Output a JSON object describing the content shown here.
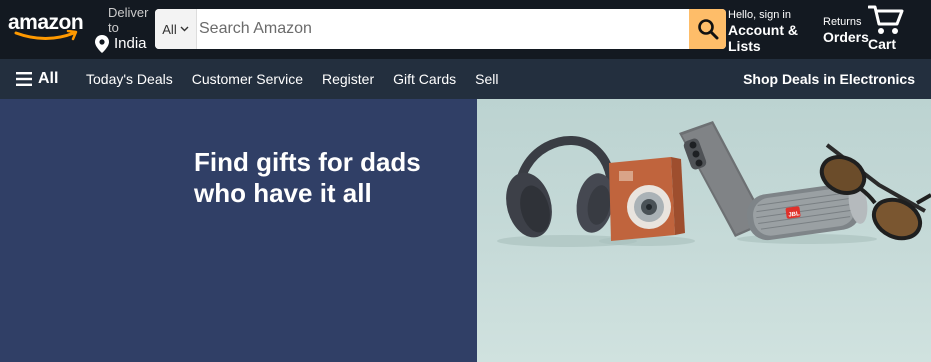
{
  "header": {
    "logo_text": "amazon",
    "deliver_label": "Deliver to",
    "deliver_country": "India",
    "search": {
      "category": "All",
      "placeholder": "Search Amazon"
    },
    "account": {
      "greeting": "Hello, sign in",
      "label": "Account & Lists"
    },
    "orders": {
      "top": "Returns",
      "label": "Orders"
    },
    "cart_label": "Cart"
  },
  "nav": {
    "all_label": "All",
    "links": [
      "Today's Deals",
      "Customer Service",
      "Register",
      "Gift Cards",
      "Sell"
    ],
    "promo": "Shop Deals in Electronics"
  },
  "hero": {
    "headline": "Find gifts for dads who have it all",
    "speaker_brand": "JBL"
  },
  "colors": {
    "header_bg": "#131921",
    "nav_bg": "#232f3e",
    "search_button": "#febd69",
    "hero_left_bg": "#303f66",
    "hero_right_bg": "#c6dad8"
  },
  "icons": [
    "location-pin-icon",
    "chevron-down-icon",
    "search-icon",
    "menu-icon",
    "cart-icon"
  ]
}
